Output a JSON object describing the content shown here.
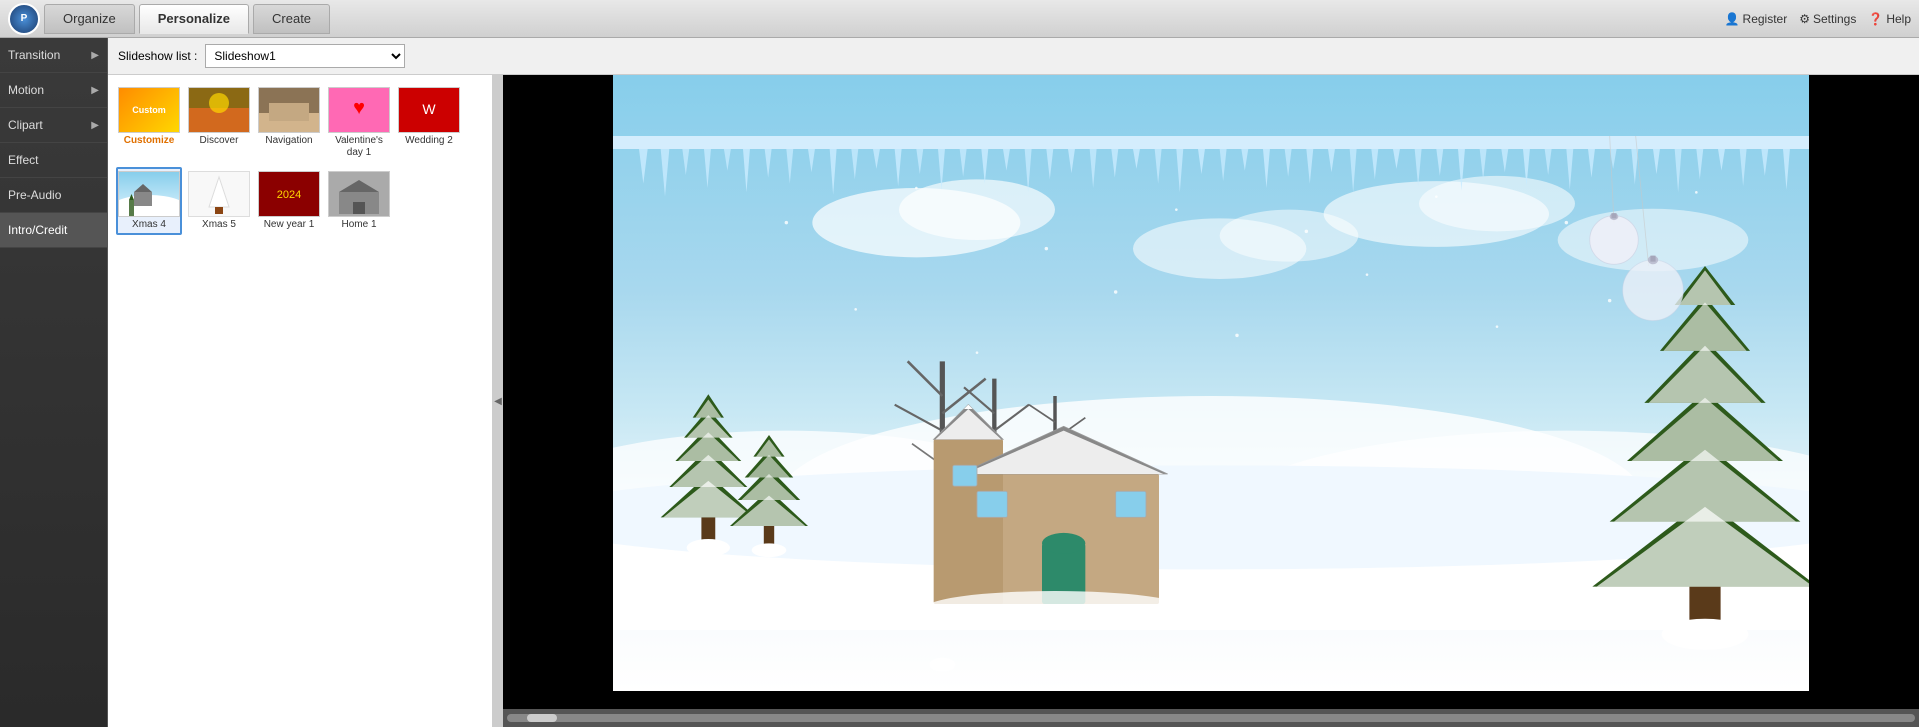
{
  "app": {
    "logo_text": "P",
    "tabs": [
      {
        "id": "organize",
        "label": "Organize",
        "active": false
      },
      {
        "id": "personalize",
        "label": "Personalize",
        "active": true
      },
      {
        "id": "create",
        "label": "Create",
        "active": false
      }
    ],
    "top_right": [
      {
        "id": "register",
        "label": "Register",
        "icon": "person-icon"
      },
      {
        "id": "settings",
        "label": "Settings",
        "icon": "gear-icon"
      },
      {
        "id": "help",
        "label": "Help",
        "icon": "question-icon"
      }
    ]
  },
  "slideshow_bar": {
    "label": "Slideshow list :",
    "value": "Slideshow1"
  },
  "sidebar": {
    "items": [
      {
        "id": "transition",
        "label": "Transition",
        "has_arrow": true,
        "active": false
      },
      {
        "id": "motion",
        "label": "Motion",
        "has_arrow": true,
        "active": false
      },
      {
        "id": "clipart",
        "label": "Clipart",
        "has_arrow": true,
        "active": false
      },
      {
        "id": "effect",
        "label": "Effect",
        "has_arrow": false,
        "active": false
      },
      {
        "id": "pre-audio",
        "label": "Pre-Audio",
        "has_arrow": false,
        "active": false
      },
      {
        "id": "intro-credit",
        "label": "Intro/Credit",
        "has_arrow": false,
        "active": true
      }
    ]
  },
  "theme_panel": {
    "items": [
      {
        "id": "customize",
        "label": "Customize",
        "thumb_class": "thumb-customize",
        "selected": false,
        "custom": true
      },
      {
        "id": "discover",
        "label": "Discover",
        "thumb_class": "thumb-discover",
        "selected": false
      },
      {
        "id": "navigation",
        "label": "Navigation",
        "thumb_class": "thumb-navigation",
        "selected": false
      },
      {
        "id": "valentines",
        "label": "Valentine's day 1",
        "thumb_class": "thumb-valentines",
        "selected": false
      },
      {
        "id": "wedding2",
        "label": "Wedding 2",
        "thumb_class": "thumb-wedding2",
        "selected": false
      },
      {
        "id": "xmas4",
        "label": "Xmas 4",
        "thumb_class": "thumb-xmas4",
        "selected": true
      },
      {
        "id": "xmas5",
        "label": "Xmas 5",
        "thumb_class": "thumb-xmas5",
        "selected": false
      },
      {
        "id": "newyear1",
        "label": "New year 1",
        "thumb_class": "thumb-newyear1",
        "selected": false
      },
      {
        "id": "home1",
        "label": "Home 1",
        "thumb_class": "thumb-home1",
        "selected": false
      }
    ]
  },
  "preview": {
    "scrollbar_visible": true
  }
}
